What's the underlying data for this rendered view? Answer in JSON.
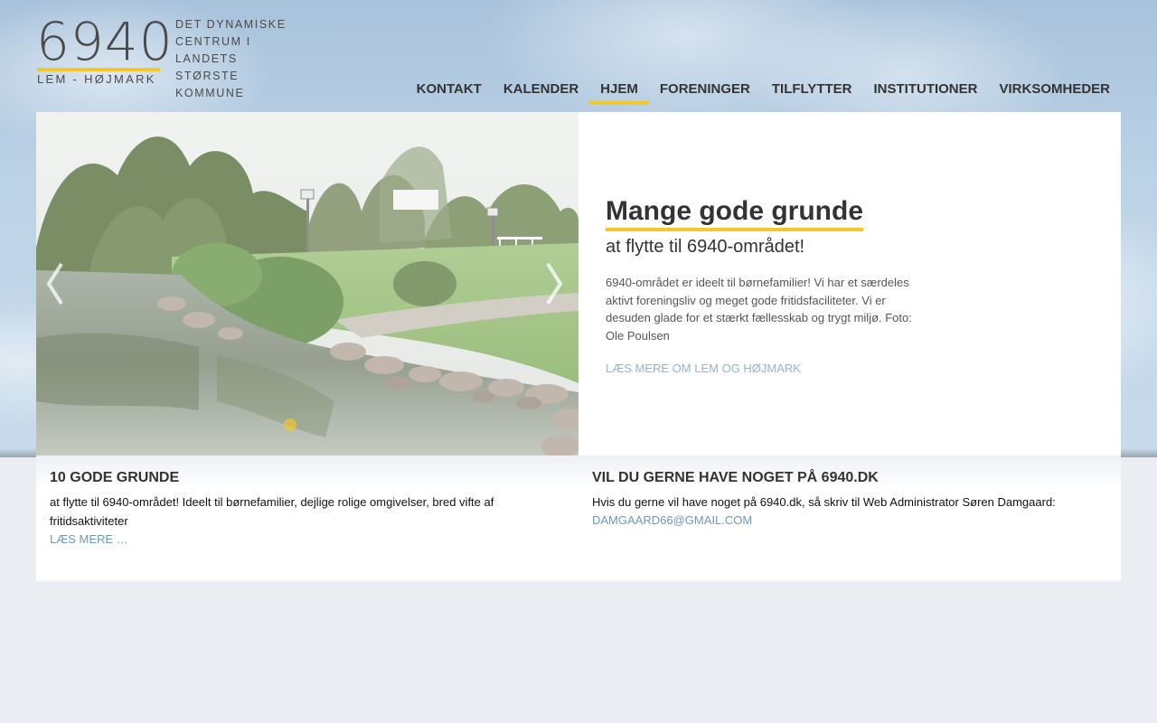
{
  "logo": {
    "number": "6940",
    "subtitle": "LEM - HØJMARK",
    "tagline_1": "DET DYNAMISKE",
    "tagline_2": "CENTRUM I LANDETS",
    "tagline_3": "STØRSTE KOMMUNE"
  },
  "nav": {
    "items": [
      "KONTAKT",
      "KALENDER",
      "HJEM",
      "FORENINGER",
      "TILFLYTTER",
      "INSTITUTIONER",
      "VIRKSOMHEDER"
    ],
    "active": "HJEM"
  },
  "slider": {
    "title": "Mange gode grunde",
    "subtitle": "at flytte til 6940-området!",
    "body": "6940-området er ideelt til børnefamilier! Vi har et særdeles aktivt foreningsliv og meget gode fritidsfaciliteter. Vi er desuden glade for et stærkt fællesskab og trygt miljø. Foto: Ole Poulsen",
    "link": "LÆS MERE OM LEM OG HØJMARK"
  },
  "left_box": {
    "title": "10 GODE GRUNDE",
    "body": "at flytte til 6940-området! Ideelt til børnefamilier, dejlige rolige omgivelser, bred vifte af fritidsaktiviteter",
    "link": "LÆS MERE …"
  },
  "right_box": {
    "title": "VIL DU GERNE HAVE NOGET PÅ 6940.DK",
    "body": "Hvis du gerne vil have noget på 6940.dk, så skriv til Web Administrator Søren Damgaard:",
    "link": "DAMGAARD66@GMAIL.COM"
  },
  "colors": {
    "accent": "#f4c82a",
    "link": "#6f98b5",
    "page_bg": "#eaeef3"
  }
}
